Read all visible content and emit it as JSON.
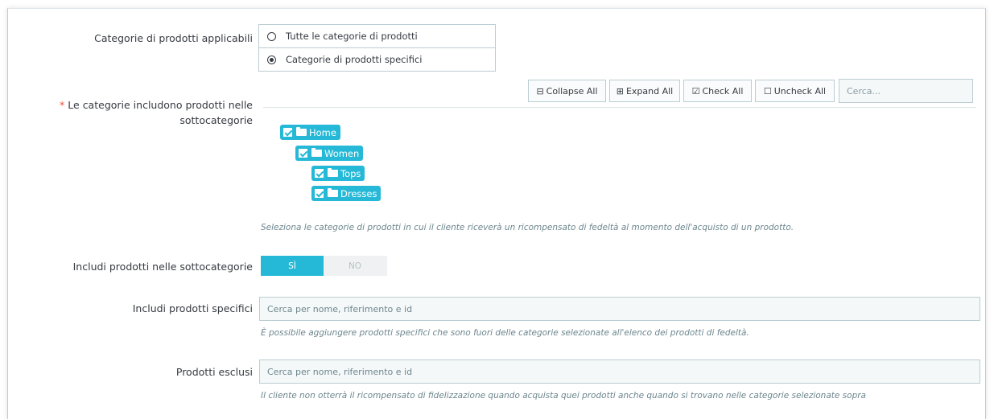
{
  "applicable_categories": {
    "label": "Categorie di prodotti applicabili",
    "options": [
      "Tutte le categorie di prodotti",
      "Categorie di prodotti specifici"
    ],
    "selected_index": 1
  },
  "category_tree": {
    "required_mark": "*",
    "label_line1": "Le categorie includono prodotti nelle",
    "label_line2": "sottocategorie",
    "toolbar": {
      "collapse_label": "Collapse All",
      "expand_label": "Expand All",
      "check_label": "Check All",
      "uncheck_label": "Uncheck All",
      "search_placeholder": "Cerca..."
    },
    "items": [
      {
        "label": "Home",
        "checked": true,
        "icon": "folder-open-icon"
      },
      {
        "label": "Women",
        "checked": true,
        "icon": "folder-open-icon"
      },
      {
        "label": "Tops",
        "checked": true,
        "icon": "folder-icon"
      },
      {
        "label": "Dresses",
        "checked": true,
        "icon": "folder-icon"
      }
    ],
    "help": "Seleziona le categorie di prodotti in cui il cliente riceverà un ricompensato di fedeltà al momento dell'acquisto di un prodotto."
  },
  "include_subcategories": {
    "label": "Includi prodotti nelle sottocategorie",
    "yes_label": "SÌ",
    "no_label": "NO",
    "value": "yes"
  },
  "include_specific": {
    "label": "Includi prodotti specifici",
    "placeholder": "Cerca per nome, riferimento e id",
    "help": "È possibile aggiungere prodotti specifici che sono fuori delle categorie selezionate all'elenco dei prodotti di fedeltà."
  },
  "excluded_products": {
    "label": "Prodotti esclusi",
    "placeholder": "Cerca per nome, riferimento e id",
    "help": "Il cliente non otterrà il ricompensato di fidelizzazione quando acquista quei prodotti anche quando si trovano nelle categorie selezionate sopra"
  },
  "colors": {
    "accent": "#25b9d7",
    "required": "#e84e3c",
    "help_text": "#6c868e"
  }
}
